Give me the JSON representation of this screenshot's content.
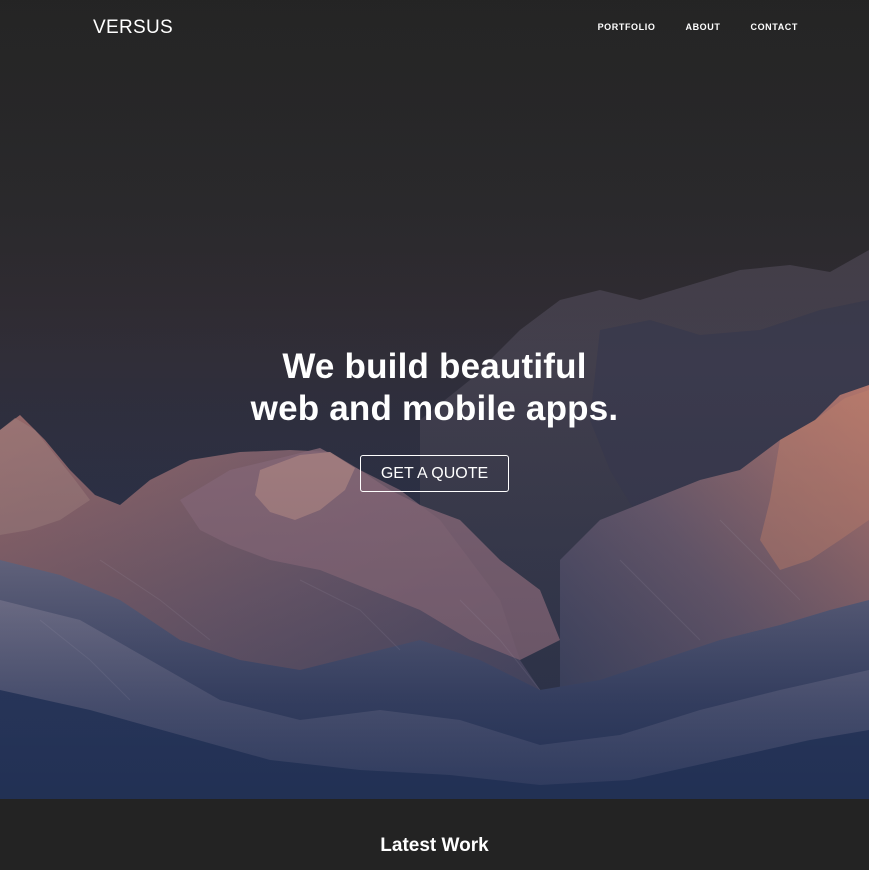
{
  "navbar": {
    "brand": "VERSUS",
    "links": [
      {
        "label": "PORTFOLIO"
      },
      {
        "label": "ABOUT"
      },
      {
        "label": "CONTACT"
      }
    ]
  },
  "hero": {
    "heading_line1": "We build beautiful",
    "heading_line2": "web and mobile apps.",
    "cta_label": "GET A QUOTE",
    "background": "mountain-range-at-dusk"
  },
  "latest": {
    "title": "Latest Work"
  },
  "colors": {
    "page_bg": "#232323",
    "text": "#ffffff",
    "sky_top": "#282828",
    "mountain_glow": "#b07870",
    "mountain_base": "#24345a"
  }
}
